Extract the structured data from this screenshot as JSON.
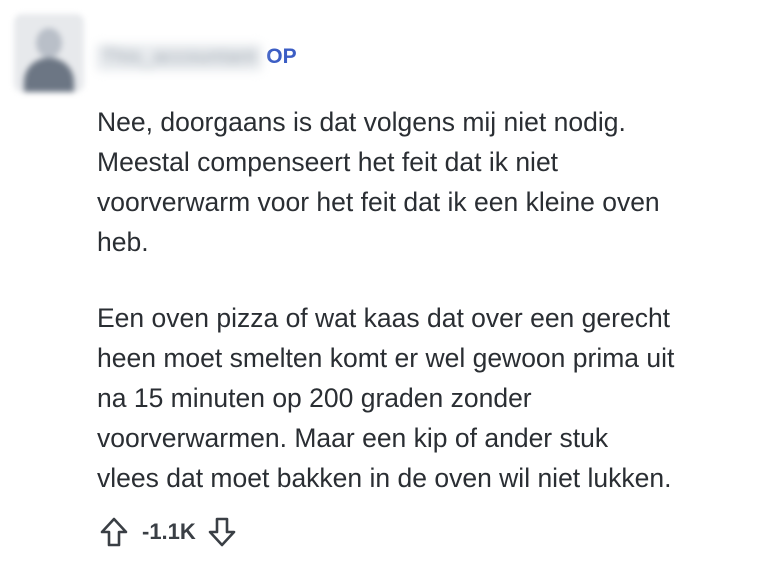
{
  "comment": {
    "author": {
      "username": "This_accountant",
      "op_badge": "OP"
    },
    "paragraphs": [
      "Nee, doorgaans is dat volgens mij niet nodig.\nMeestal compenseert het feit dat ik niet\nvoorverwarm voor het feit dat ik een kleine oven\nheb.",
      "Een oven pizza of wat kaas dat over een gerecht\nheen moet smelten komt er wel gewoon prima uit\nna 15 minuten op 200 graden zonder\nvoorverwarmen. Maar een kip of ander stuk\nvlees dat moet bakken in de oven wil niet lukken."
    ],
    "votes": {
      "score": "-1.1K",
      "upvote_icon": "arrow-up-outline-icon",
      "downvote_icon": "arrow-down-outline-icon"
    }
  },
  "colors": {
    "op_badge": "#3b5dc4",
    "text": "#2a2e33",
    "icon": "#3a3f45"
  }
}
